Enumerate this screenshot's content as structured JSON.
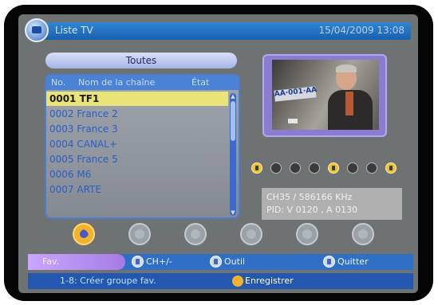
{
  "header": {
    "title": "Liste TV",
    "datetime": "15/04/2009 13:08"
  },
  "group_label": "Toutes",
  "columns": {
    "no": "No.",
    "name": "Nom de la chaîne",
    "state": "État"
  },
  "channels": [
    {
      "label": "0001 TF1"
    },
    {
      "label": "0002 France 2"
    },
    {
      "label": "0003 France 3"
    },
    {
      "label": "0004 CANAL+"
    },
    {
      "label": "0005 France 5"
    },
    {
      "label": "0006 M6"
    },
    {
      "label": "0007 ARTE"
    }
  ],
  "selected_index": 0,
  "preview": {
    "sign_text": "AA·001·AA"
  },
  "info": {
    "line1": "CH35 / 586166 KHz",
    "line2": "PID: V 0120 , A 0130"
  },
  "status_icons": [
    "tv-icon",
    "circle-icon",
    "circle-icon",
    "circle-icon",
    "lock-icon",
    "circle-icon",
    "circle-icon",
    "person-icon"
  ],
  "help": {
    "fav": "Fav.",
    "ch": "CH+/-",
    "outil": "Outil",
    "quit": "Quitter"
  },
  "status": {
    "left": "1-8: Créer groupe fav.",
    "right": "Enregistrer"
  },
  "colors": {
    "accent": "#2f6fc5",
    "selection": "#e8e477",
    "fav": "#c9a6ff"
  }
}
